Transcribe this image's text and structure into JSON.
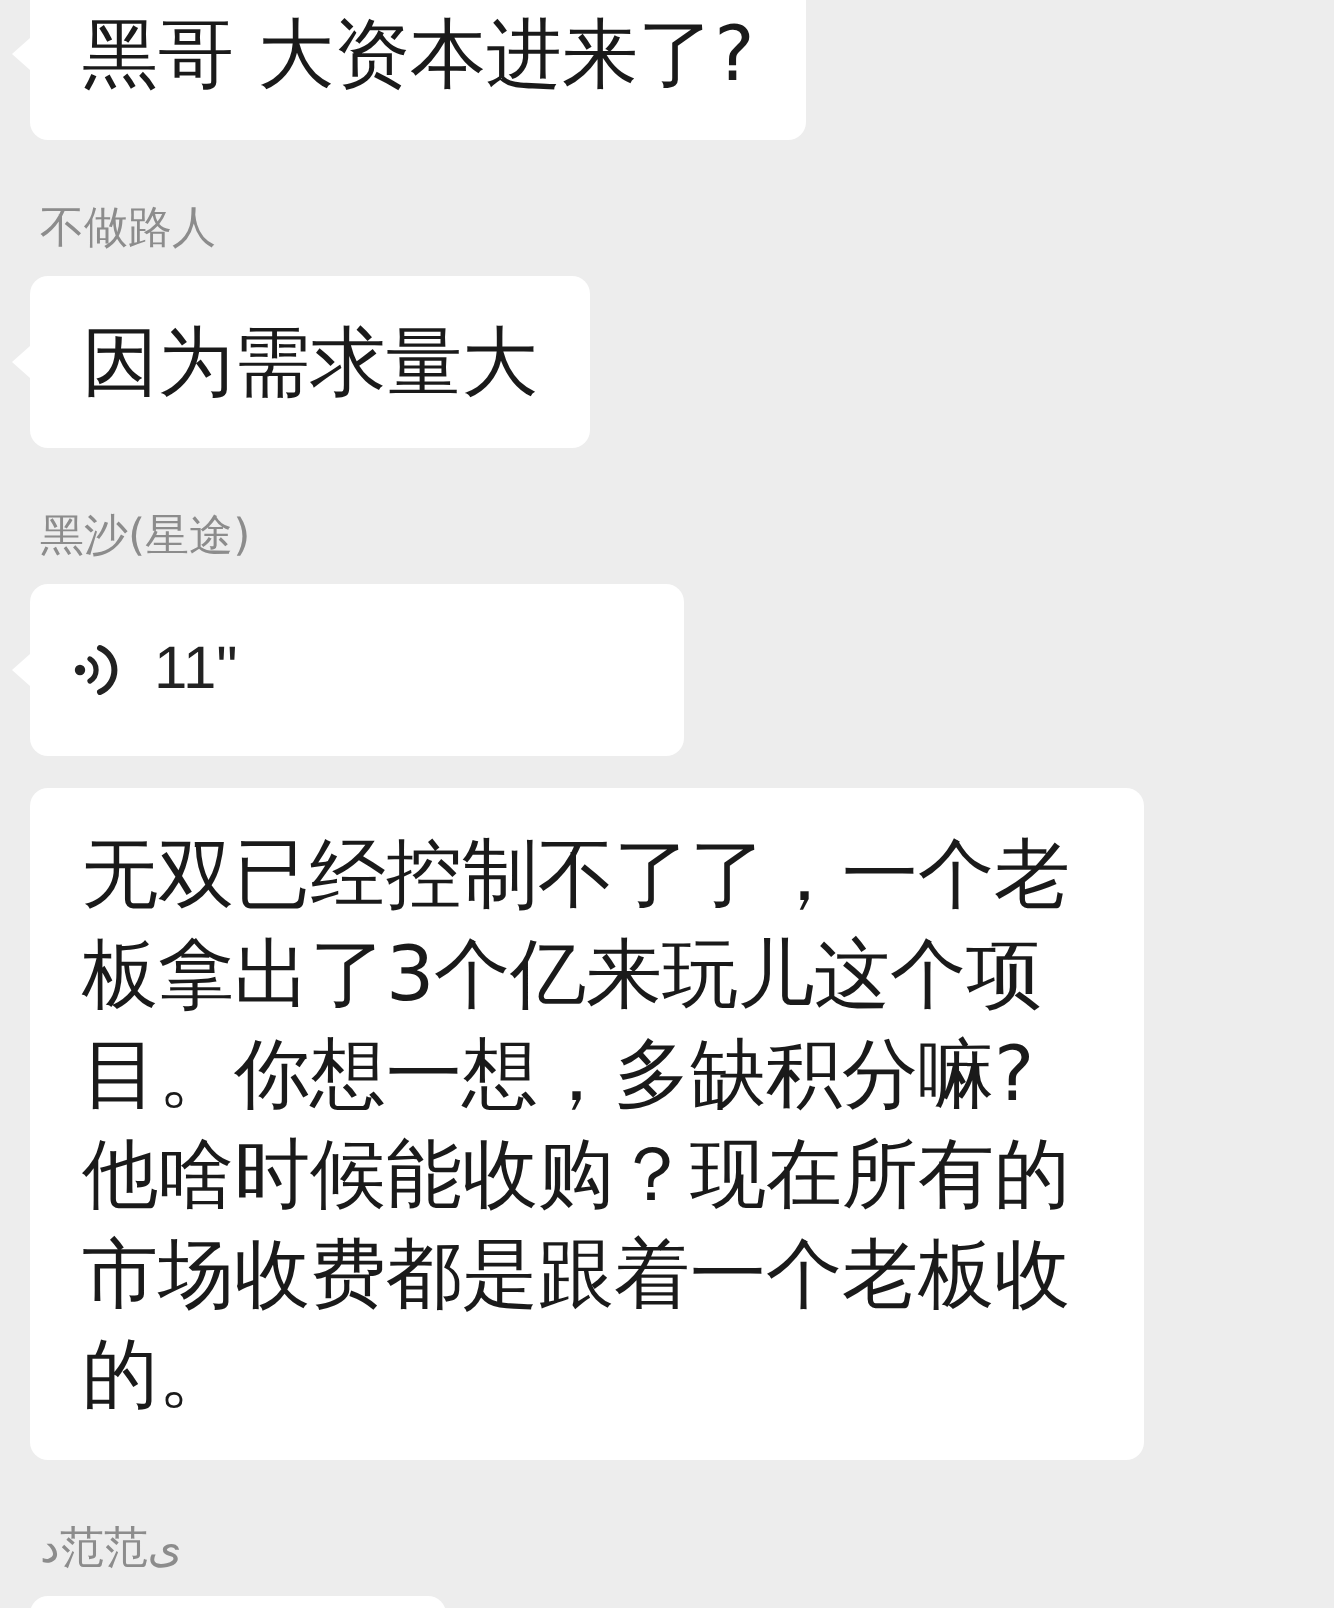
{
  "messages": [
    {
      "kind": "text",
      "tail": true,
      "text": "黑哥 大资本进来了?"
    },
    {
      "sender": "不做路人",
      "kind": "text",
      "tail": true,
      "text": "因为需求量大"
    },
    {
      "sender": "黑沙(星途)",
      "kind": "voice",
      "tail": true,
      "duration": "11\""
    },
    {
      "kind": "text",
      "tail": false,
      "text": "无双已经控制不了了，一个老板拿出了3个亿来玩儿这个项目。你想一想，多缺积分嘛?他啥时候能收购？现在所有的市场收费都是跟着一个老板收的。"
    },
    {
      "sender": "د范范ی",
      "kind": "partial"
    }
  ]
}
